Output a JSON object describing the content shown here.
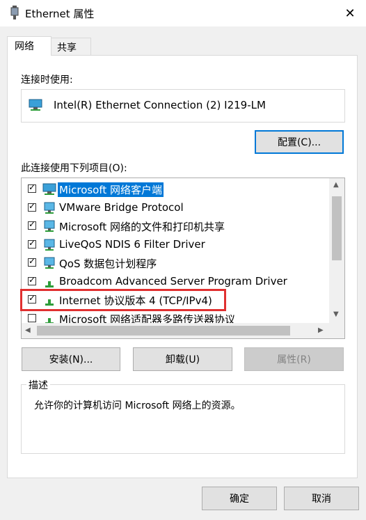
{
  "window": {
    "title": "Ethernet 属性",
    "close_glyph": "✕"
  },
  "tabs": [
    {
      "label": "网络"
    },
    {
      "label": "共享"
    }
  ],
  "connect_using": {
    "label": "连接时使用:",
    "adapter_name": "Intel(R) Ethernet Connection (2) I219-LM",
    "configure_button": "配置(C)..."
  },
  "items_section": {
    "label": "此连接使用下列项目(O):",
    "items": [
      {
        "label": "Microsoft 网络客户端",
        "checked": true,
        "selected": true,
        "icon": "network-client-icon"
      },
      {
        "label": "VMware Bridge Protocol",
        "checked": true,
        "icon": "network-service-icon"
      },
      {
        "label": "Microsoft 网络的文件和打印机共享",
        "checked": true,
        "icon": "network-service-icon"
      },
      {
        "label": "LiveQoS NDIS 6 Filter Driver",
        "checked": true,
        "icon": "network-service-icon"
      },
      {
        "label": "QoS 数据包计划程序",
        "checked": true,
        "icon": "network-service-icon"
      },
      {
        "label": "Broadcom Advanced Server Program Driver",
        "checked": true,
        "icon": "protocol-icon"
      },
      {
        "label": "Internet 协议版本 4 (TCP/IPv4)",
        "checked": true,
        "icon": "protocol-icon",
        "highlighted": true
      },
      {
        "label": "Microsoft 网络适配器多路传送器协议",
        "checked": false,
        "icon": "protocol-icon"
      }
    ]
  },
  "buttons": {
    "install": "安装(N)...",
    "uninstall": "卸载(U)",
    "properties": "属性(R)"
  },
  "description": {
    "legend": "描述",
    "text": "允许你的计算机访问 Microsoft 网络上的资源。"
  },
  "footer": {
    "ok": "确定",
    "cancel": "取消"
  },
  "colors": {
    "selection": "#0078d7",
    "highlight_box": "#e03030",
    "focus_border": "#0078d7"
  }
}
